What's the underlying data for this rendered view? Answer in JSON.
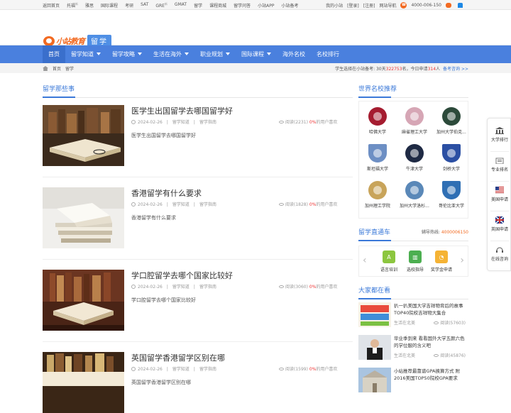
{
  "topbar": {
    "links": [
      "返回首页",
      "托福",
      "雅思",
      "国际课程",
      "考研",
      "SAT",
      "GRE",
      "GMAT",
      "留学",
      "课程商城",
      "留学问答",
      "小站APP",
      "小站备考"
    ],
    "sup_flags": [
      "",
      "新",
      "",
      "",
      "",
      "",
      "新",
      "",
      "",
      "",
      "",
      "",
      ""
    ],
    "user": "我的小站",
    "login": "[登录]",
    "register": "[注册]",
    "sitenav": "网站导航",
    "phone": "4000-006-150"
  },
  "logo": {
    "brand": "小站教育",
    "tag": "留学"
  },
  "nav": {
    "items": [
      {
        "label": "首页",
        "caret": false,
        "active": true
      },
      {
        "label": "留学知道",
        "caret": true
      },
      {
        "label": "留学攻略",
        "caret": true
      },
      {
        "label": "生活在海外",
        "caret": true
      },
      {
        "label": "职业规划",
        "caret": true
      },
      {
        "label": "国际课程",
        "caret": true
      },
      {
        "label": "海外名校",
        "caret": false
      },
      {
        "label": "名校排行",
        "caret": false
      }
    ]
  },
  "breadcrumb": {
    "home": "首页",
    "current": "留学",
    "stats_prefix": "学生选择在小站备考: 30天",
    "stats_30d": "322753",
    "stats_mid": "名，今日申请",
    "stats_today": "314",
    "stats_suffix": "人",
    "consult": "备考咨询 >>"
  },
  "main": {
    "section_title": "留学那些事",
    "articles": [
      {
        "title": "医学生出国留学去哪国留学好",
        "date": "2024-02-26",
        "cat1": "留学知道",
        "cat2": "留学指南",
        "views": "阅读(2231)",
        "like_pct": "0%",
        "like_suffix": "的用户喜欢",
        "desc": "医学生出国留学去哪国留学好"
      },
      {
        "title": "香港留学有什么要求",
        "date": "2024-02-26",
        "cat1": "留学知道",
        "cat2": "留学指南",
        "views": "阅读(1828)",
        "like_pct": "0%",
        "like_suffix": "的用户喜欢",
        "desc": "香港留学有什么要求"
      },
      {
        "title": "学口腔留学去哪个国家比较好",
        "date": "2024-02-26",
        "cat1": "留学知道",
        "cat2": "留学指南",
        "views": "阅读(3060)",
        "like_pct": "0%",
        "like_suffix": "的用户喜欢",
        "desc": "学口腔留学去哪个国家比较好"
      },
      {
        "title": "英国留学香港留学区别在哪",
        "date": "2024-02-26",
        "cat1": "留学知道",
        "cat2": "留学指南",
        "views": "阅读(1599)",
        "like_pct": "0%",
        "like_suffix": "的用户喜欢",
        "desc": "英国留学香港留学区别在哪"
      }
    ]
  },
  "sidebar": {
    "schools_title": "世界名校推荐",
    "schools": [
      {
        "name": "哈佛大学",
        "color": "#a51c30"
      },
      {
        "name": "麻省理工大学",
        "color": "#d6a6b5"
      },
      {
        "name": "加州大学伯克...",
        "color": "#2c4a3a"
      },
      {
        "name": "斯坦福大学",
        "color": "#6d8fc4"
      },
      {
        "name": "牛津大学",
        "color": "#1f2a44"
      },
      {
        "name": "剑桥大学",
        "color": "#2b4fa3"
      },
      {
        "name": "加州理工学院",
        "color": "#c8a45a"
      },
      {
        "name": "加州大学洛杉...",
        "color": "#5a88b8"
      },
      {
        "name": "哥伦比亚大学",
        "color": "#2f6fb4"
      }
    ],
    "direct_title": "留学直通车",
    "hotline_label": "辅导热线:",
    "hotline": "4000006150",
    "direct_items": [
      {
        "label": "语言培训",
        "color": "#8cc63f"
      },
      {
        "label": "选校指导",
        "color": "#4caf50"
      },
      {
        "label": "奖学金申请",
        "color": "#f5b335"
      }
    ],
    "popular_title": "大家都在看",
    "popular": [
      {
        "title": "扒一扒美国大学吉祥物背后的故事 TOP40院校吉祥物大集合",
        "cat": "生活在北美",
        "views": "阅读(57603)"
      },
      {
        "title": "毕业季到来 看看国外大学五颜六色的学位服的含义吧",
        "cat": "生活在北美",
        "views": "阅读(45876)"
      },
      {
        "title": "小站推荐最靠谱GPA换算方式 附2016美国TOP50院校GPA要求",
        "cat": "",
        "views": ""
      }
    ]
  },
  "float": {
    "items": [
      "大学排行",
      "专业排名",
      "美国申请",
      "英国申请",
      "在线咨询"
    ]
  }
}
